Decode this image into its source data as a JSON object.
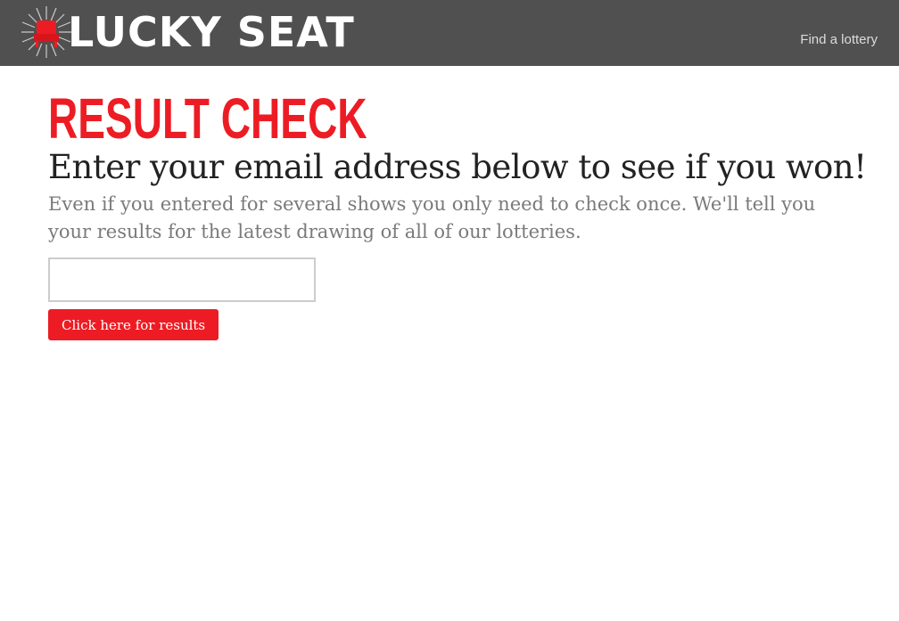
{
  "header": {
    "logo_text": "LUCKY SEAT",
    "logo_icon": "seat-starburst-icon",
    "nav_link": "Find a lottery"
  },
  "main": {
    "title": "RESULT CHECK",
    "subtitle": "Enter your email address below to see if you won!",
    "description": "Even if you entered for several shows you only need to check once. We'll tell you your results for the latest drawing of all of our lotteries.",
    "email_value": "",
    "button_label": "Click here for results"
  },
  "colors": {
    "navbar": "#505050",
    "accent": "#ed1c24",
    "nav_text": "#dcdcdc"
  }
}
